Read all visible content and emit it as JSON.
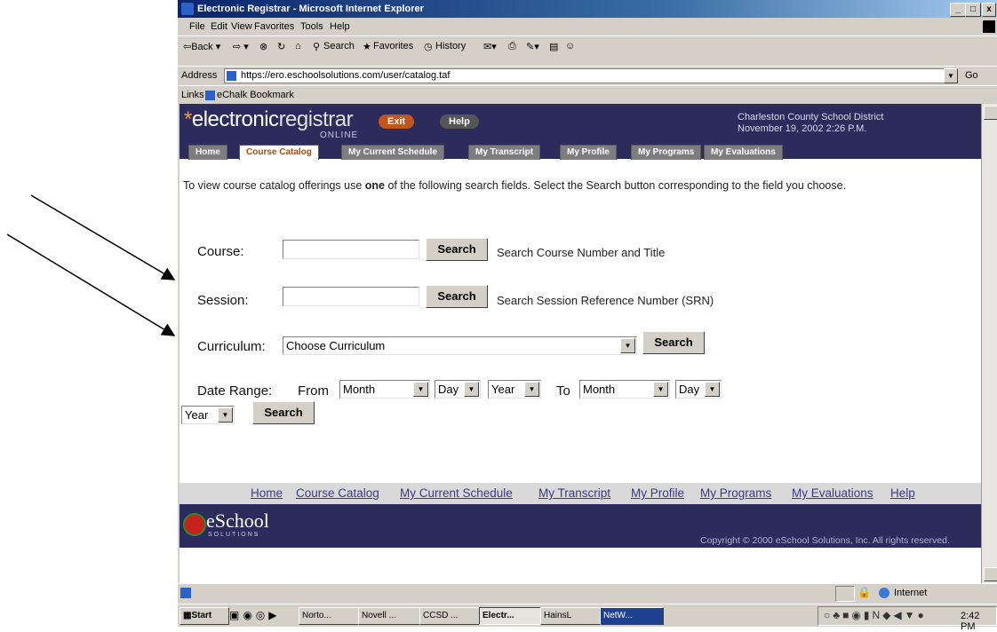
{
  "window": {
    "title": "Electronic Registrar - Microsoft Internet Explorer",
    "min": "_",
    "max": "□",
    "close": "x"
  },
  "menu": [
    "File",
    "Edit",
    "View",
    "Favorites",
    "Tools",
    "Help"
  ],
  "toolbar": {
    "back": "⇦Back ▾",
    "forward": "⇨ ▾",
    "stop": "⊗",
    "refresh": "↻",
    "home": "⌂",
    "search": "Search",
    "favorites": "Favorites",
    "history": "History",
    "mail": "✉▾",
    "print": "⎙",
    "edit": "✎▾",
    "discuss": "▤",
    "messenger": "☺"
  },
  "address": {
    "label": "Address",
    "url": "https://ero.eschoolsolutions.com/user/catalog.taf",
    "go": "Go"
  },
  "links": {
    "label": "Links",
    "item": "eChalk Bookmark"
  },
  "site": {
    "logo_star": "*",
    "logo_a": "electronic",
    "logo_b": "registrar",
    "logo_sub": "ONLINE",
    "exit": "Exit",
    "help": "Help",
    "district": "Charleston County School District",
    "date": "November 19, 2002 2:26 P.M.",
    "tabs": [
      "Home",
      "Course Catalog",
      "My Current Schedule",
      "My Transcript",
      "My Profile",
      "My Programs",
      "My Evaluations"
    ]
  },
  "page": {
    "intro_a": "To view course catalog offerings use ",
    "intro_bold": "one",
    "intro_b": " of the following search fields. Select the Search button corresponding to the field you choose.",
    "course_label": "Course:",
    "course_hint": "Search Course Number and Title",
    "session_label": "Session:",
    "session_hint": "Search Session Reference Number (SRN)",
    "curriculum_label": "Curriculum:",
    "curriculum_value": "Choose Curriculum",
    "date_label": "Date Range:",
    "from_label": "From",
    "to_label": "To",
    "month": "Month",
    "day": "Day",
    "year": "Year",
    "search": "Search",
    "course_value": "",
    "session_value": ""
  },
  "footer": {
    "links": [
      "Home",
      "Course Catalog",
      "My Current Schedule",
      "My Transcript",
      "My Profile",
      "My Programs",
      "My Evaluations",
      "Help"
    ],
    "brand": "eSchool",
    "brand_sub": "SOLUTIONS",
    "copyright": "Copyright © 2000 eSchool Solutions, Inc. All rights reserved."
  },
  "status": {
    "zone": "Internet"
  },
  "taskbar": {
    "start": "Start",
    "tasks": [
      "Norto...",
      "Novell ...",
      "CCSD ...",
      "Electr...",
      "HainsL",
      "NetW..."
    ],
    "clock": "2:42 PM"
  },
  "colors": {
    "header": "#2c2c5c",
    "active_tab_text": "#b34a00",
    "exit_btn": "#c1551c",
    "logo_star": "#ff9a2a"
  }
}
